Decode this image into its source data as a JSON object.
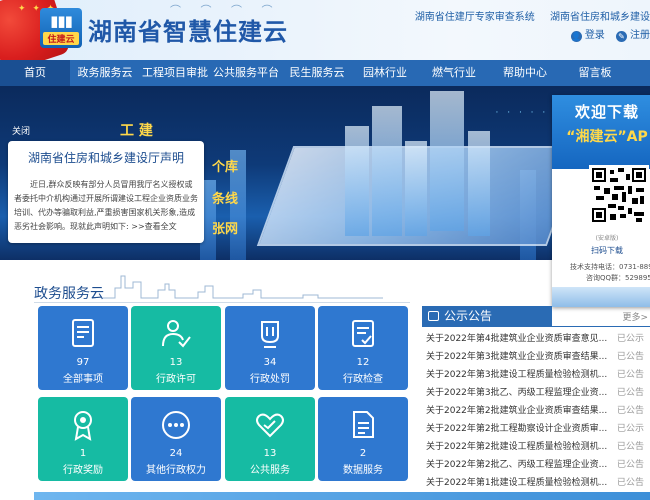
{
  "header": {
    "site_title": "湖南省智慧住建云",
    "logo_text": "住建云",
    "top_links": [
      "湖南省住建厅专家审查系统",
      "湖南省住房和城乡建设"
    ],
    "login": "登录",
    "register": "注册"
  },
  "nav": [
    {
      "label": "首页",
      "active": true
    },
    {
      "label": "政务服务云"
    },
    {
      "label": "工程项目审批"
    },
    {
      "label": "公共服务平台"
    },
    {
      "label": "民生服务云"
    },
    {
      "label": "园林行业"
    },
    {
      "label": "燃气行业"
    },
    {
      "label": "帮助中心"
    },
    {
      "label": "留言板"
    }
  ],
  "banner": {
    "close": "关闭",
    "labels": [
      "个库",
      "条线",
      "张网"
    ]
  },
  "notice": {
    "title": "湖南省住房和城乡建设厅声明",
    "body": "近日,群众反映有部分人员冒用我厅名义授权或者委托中介机构通过开展所谓建设工程企业资质业务培训、代办等骗取利益,严重损害国家机关形象,造成恶劣社会影响。现就此声明如下: >>查看全文"
  },
  "qr": {
    "welcome": "欢迎下载",
    "app": "“湘建云”AP",
    "tip": "(安卓版)",
    "scan": "扫码下载",
    "phone": "技术支持电话：0731-889",
    "qq": "咨询QQ群：529895"
  },
  "section": {
    "title": "政务服务云"
  },
  "tiles": [
    {
      "count": "97",
      "label": "全部事项",
      "color": "blue",
      "icon": "document-list-icon"
    },
    {
      "count": "13",
      "label": "行政许可",
      "color": "teal",
      "icon": "person-check-icon"
    },
    {
      "count": "34",
      "label": "行政处罚",
      "color": "blue",
      "icon": "penalty-cup-icon"
    },
    {
      "count": "12",
      "label": "行政检查",
      "color": "blue",
      "icon": "checklist-icon"
    },
    {
      "count": "1",
      "label": "行政奖励",
      "color": "teal",
      "icon": "award-medal-icon"
    },
    {
      "count": "24",
      "label": "其他行政权力",
      "color": "blue",
      "icon": "more-dots-icon"
    },
    {
      "count": "13",
      "label": "公共服务",
      "color": "teal",
      "icon": "heart-hands-icon"
    },
    {
      "count": "2",
      "label": "数据服务",
      "color": "blue",
      "icon": "data-doc-icon"
    }
  ],
  "announcements": {
    "title": "公示公告",
    "more": "更多>",
    "items": [
      {
        "text": "关于2022年第4批建筑业企业资质审查意见...",
        "status": "已公示"
      },
      {
        "text": "关于2022年第3批建筑业企业资质审查结果...",
        "status": "已公告"
      },
      {
        "text": "关于2022年第3批建设工程质量检验检测机...",
        "status": "已公告"
      },
      {
        "text": "关于2022年第3批乙、丙级工程监理企业资...",
        "status": "已公告"
      },
      {
        "text": "关于2022年第2批建筑业企业资质审查结果...",
        "status": "已公告"
      },
      {
        "text": "关于2022年第2批工程勘察设计企业资质审...",
        "status": "已公示"
      },
      {
        "text": "关于2022年第2批建设工程质量检验检测机...",
        "status": "已公告"
      },
      {
        "text": "关于2022年第2批乙、丙级工程监理企业资...",
        "status": "已公告"
      },
      {
        "text": "关于2022年第1批建设工程质量检验检测机...",
        "status": "已公告"
      }
    ]
  }
}
